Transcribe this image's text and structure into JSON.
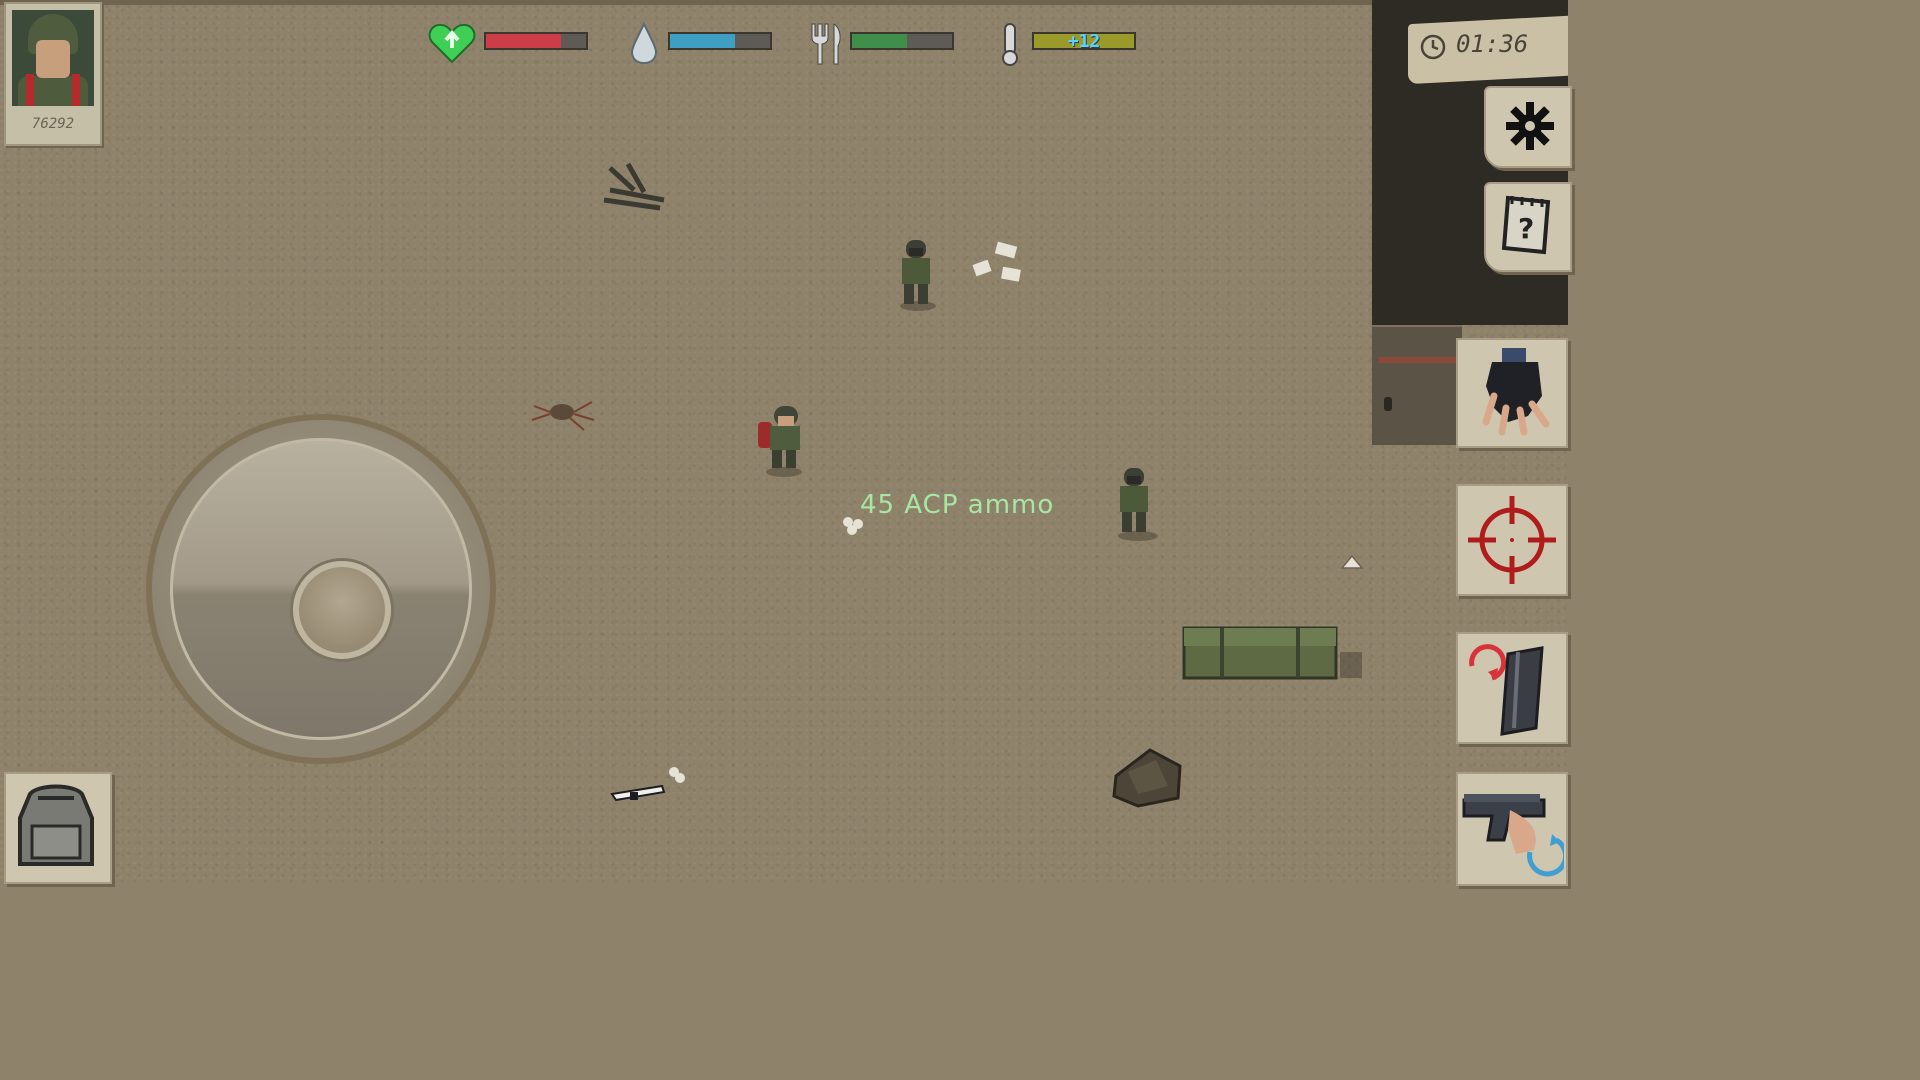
{
  "hud": {
    "score": "76292",
    "stats": [
      {
        "name": "health",
        "icon": "heart-icon",
        "level": 0.75,
        "color": "#cc3d48",
        "label": ""
      },
      {
        "name": "thirst",
        "icon": "water-drop-icon",
        "level": 0.65,
        "color": "#3f9fc2",
        "label": ""
      },
      {
        "name": "hunger",
        "icon": "fork-knife-icon",
        "level": 0.55,
        "color": "#3f8f4a",
        "label": ""
      },
      {
        "name": "temperature",
        "icon": "thermometer-icon",
        "level": 1.0,
        "color": "#9a9a2a",
        "label": "+12"
      }
    ],
    "clock": "01:36"
  },
  "buttons": {
    "settings": "gear-icon",
    "quests": "notepad-question-icon",
    "interact": "grab-hand-icon",
    "aim": "crosshair-icon",
    "reload": "reload-magazine-icon",
    "weapon": "pistol-swap-icon",
    "inventory": "backpack-icon"
  },
  "world": {
    "pickup_label": "45 ACP ammo"
  }
}
